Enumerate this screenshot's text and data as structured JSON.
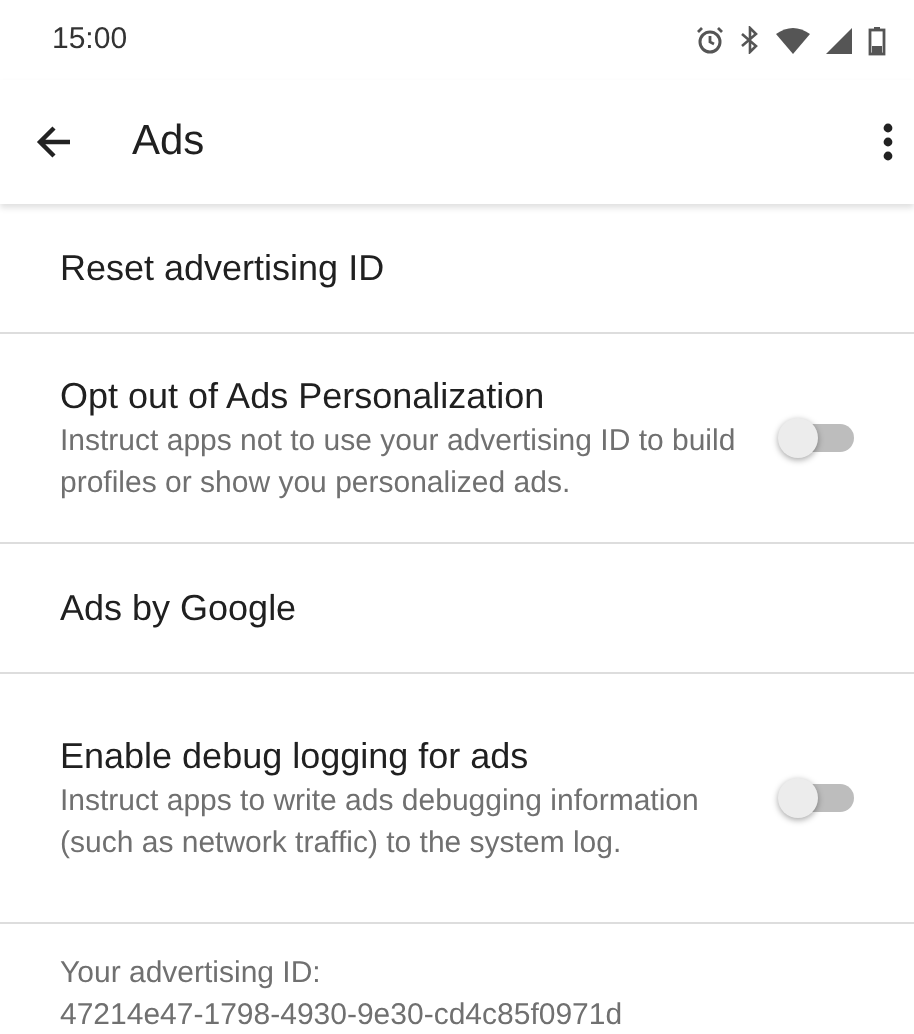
{
  "status_bar": {
    "time": "15:00"
  },
  "app_bar": {
    "title": "Ads"
  },
  "items": [
    {
      "kind": "action",
      "title": "Reset advertising ID"
    },
    {
      "kind": "toggle",
      "title": "Opt out of Ads Personalization",
      "summary": "Instruct apps not to use your advertising ID to build profiles or show you personalized ads.",
      "on": false
    },
    {
      "kind": "action",
      "title": "Ads by Google"
    },
    {
      "kind": "toggle",
      "title": "Enable debug logging for ads",
      "summary": "Instruct apps to write ads debugging information (such as network traffic) to the system log.",
      "on": false
    },
    {
      "kind": "info",
      "summary": "Your advertising ID:\n47214e47-1798-4930-9e30-cd4c85f0971d"
    }
  ]
}
